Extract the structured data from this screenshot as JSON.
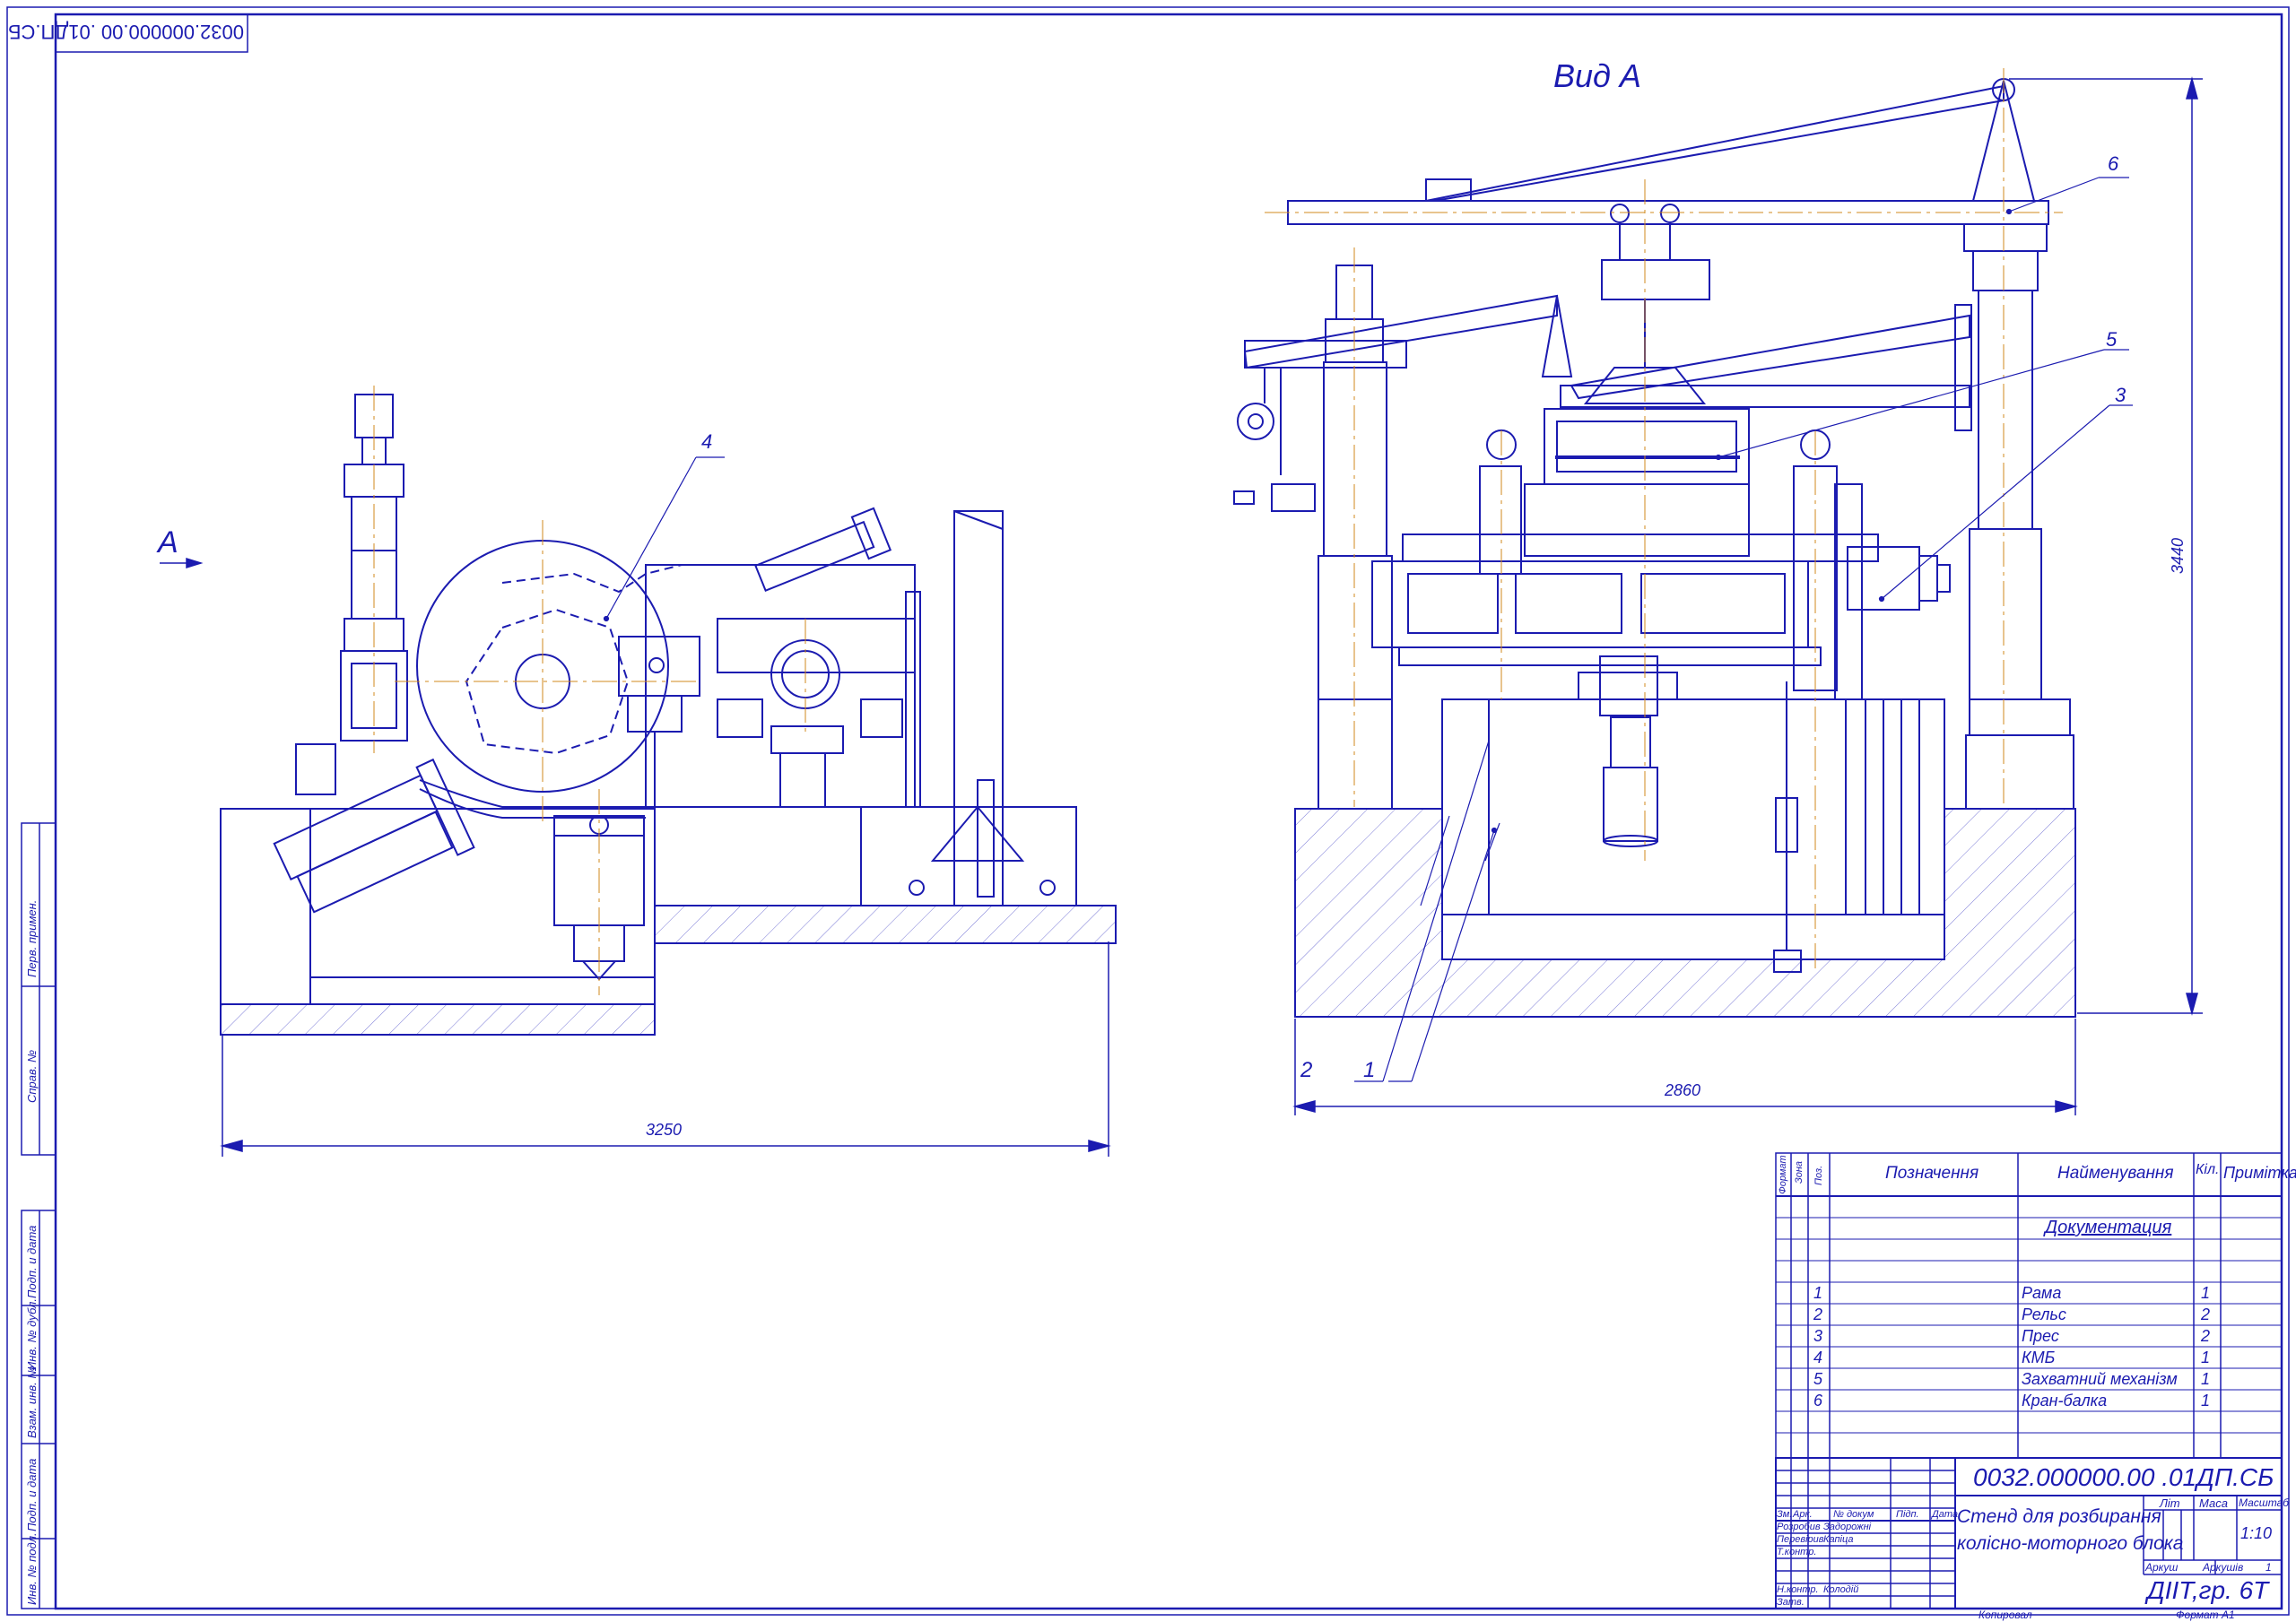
{
  "sheet": {
    "code_top_stamp": "0032.000000.00 .01ДП.СБ",
    "view_title": "Вид А",
    "view_arrow_label": "А",
    "bottom_left_caption": "Копировал",
    "bottom_right_caption": "Формат  А1"
  },
  "dimensions": {
    "left_width": "3250",
    "right_width": "2860",
    "right_height": "3440"
  },
  "callouts": {
    "c1": "1",
    "c2": "2",
    "c3": "3",
    "c4": "4",
    "c5": "5",
    "c6": "6"
  },
  "side_strip": {
    "perv_primen": "Перв. примен.",
    "sprav_no": "Справ. №",
    "podp_data_1": "Подп. и дата",
    "inv_dubl": "Инв. № дубл.",
    "vzam_inv": "Взам. инв. №",
    "podp_data_2": "Подп. и дата",
    "inv_podl": "Инв. № подл."
  },
  "spec": {
    "headers": {
      "format": "Формат",
      "zona": "Зона",
      "poz": "Поз.",
      "designation": "Позначення",
      "name": "Найменування",
      "qty": "Кіл.",
      "note": "Примітка"
    },
    "section_title": "Документация",
    "rows": [
      {
        "poz": "1",
        "name": "Рама",
        "qty": "1"
      },
      {
        "poz": "2",
        "name": "Рельс",
        "qty": "2"
      },
      {
        "poz": "3",
        "name": "Прес",
        "qty": "2"
      },
      {
        "poz": "4",
        "name": "КМБ",
        "qty": "1"
      },
      {
        "poz": "5",
        "name": "Захватний механізм",
        "qty": "1"
      },
      {
        "poz": "6",
        "name": "Кран-балка",
        "qty": "1"
      }
    ]
  },
  "title_block": {
    "doc_code": "0032.000000.00 .01ДП.СБ",
    "title_line1": "Стенд для розбирання",
    "title_line2": "колісно-моторного блока",
    "col_zm": "Зм.",
    "col_ark": "Арк.",
    "col_doc": "№ докум",
    "col_sign": "Підп.",
    "col_date": "Дата",
    "role_razrob": "Розробив",
    "person_razrob": "Задорожні",
    "role_perev": "Перевірив",
    "person_perev": "Капіца",
    "role_tkontr": "Т.контр.",
    "role_nkontr": "Н.контр.",
    "person_nkontr": "Колодій",
    "role_zatv": "Затв.",
    "lit": "Літ",
    "masa": "Маса",
    "masshtab": "Масштаб",
    "scale_value": "1:10",
    "arkush": "Аркуш",
    "arkushiv": "Аркушів",
    "arkushiv_value": "1",
    "org": "ДІІТ,гр. 6Т"
  },
  "colors": {
    "line": "#1b1bb0",
    "axis": "#d08a1c",
    "hatch": "#6a6ad0",
    "paper": "#ffffff"
  }
}
